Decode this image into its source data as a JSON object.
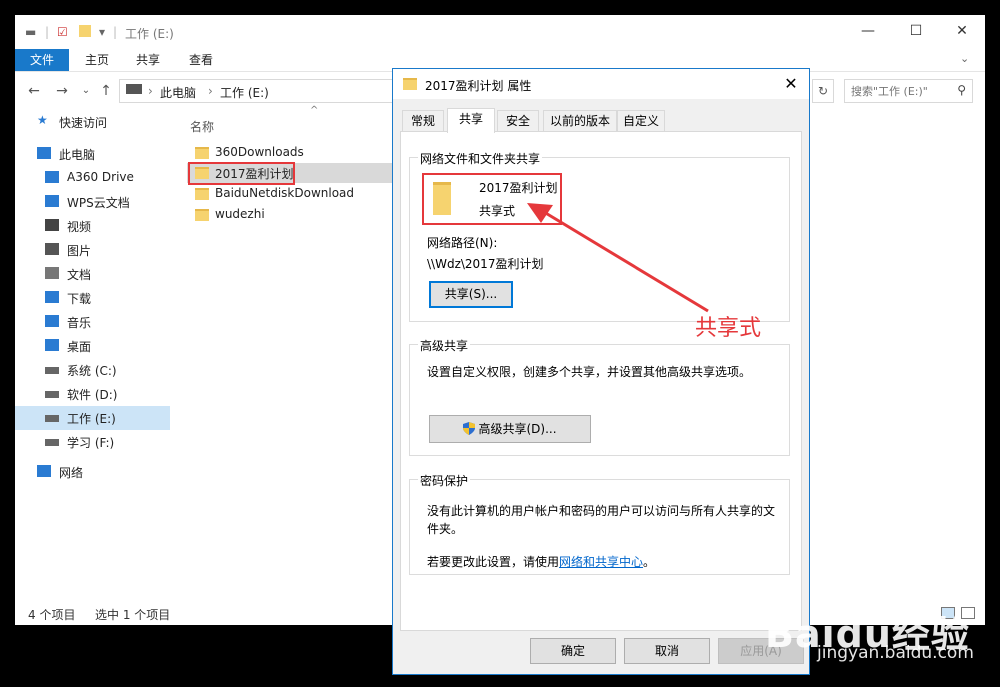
{
  "explorer": {
    "title": "工作 (E:)",
    "ribbon_tabs": [
      "文件",
      "主页",
      "共享",
      "查看"
    ],
    "breadcrumb": [
      "此电脑",
      "工作 (E:)"
    ],
    "search_placeholder": "搜索\"工作 (E:)\"",
    "column_name": "名称",
    "sidebar": [
      {
        "label": "快速访问",
        "icon": "star-icon"
      },
      {
        "label": "此电脑",
        "icon": "computer-icon"
      },
      {
        "label": "A360 Drive",
        "icon": "cloud-icon"
      },
      {
        "label": "WPS云文档",
        "icon": "cloud-icon"
      },
      {
        "label": "视频",
        "icon": "video-icon"
      },
      {
        "label": "图片",
        "icon": "picture-icon"
      },
      {
        "label": "文档",
        "icon": "document-icon"
      },
      {
        "label": "下载",
        "icon": "download-icon"
      },
      {
        "label": "音乐",
        "icon": "music-icon"
      },
      {
        "label": "桌面",
        "icon": "desktop-icon"
      },
      {
        "label": "系统 (C:)",
        "icon": "drive-icon"
      },
      {
        "label": "软件 (D:)",
        "icon": "drive-icon"
      },
      {
        "label": "工作 (E:)",
        "icon": "drive-icon",
        "selected": true
      },
      {
        "label": "学习 (F:)",
        "icon": "drive-icon"
      },
      {
        "label": "网络",
        "icon": "network-icon"
      }
    ],
    "files": [
      {
        "name": "360Downloads"
      },
      {
        "name": "2017盈利计划",
        "selected": true
      },
      {
        "name": "BaiduNetdiskDownload"
      },
      {
        "name": "wudezhi"
      }
    ],
    "status": {
      "count": "4 个项目",
      "selection": "选中 1 个项目"
    }
  },
  "dialog": {
    "title": "2017盈利计划 属性",
    "tabs": [
      "常规",
      "共享",
      "安全",
      "以前的版本",
      "自定义"
    ],
    "network_group": {
      "title": "网络文件和文件夹共享",
      "folder_name": "2017盈利计划",
      "share_state": "共享式",
      "path_label": "网络路径(N):",
      "path_value": "\\\\Wdz\\2017盈利计划",
      "share_button": "共享(S)..."
    },
    "advanced_group": {
      "title": "高级共享",
      "description": "设置自定义权限，创建多个共享，并设置其他高级共享选项。",
      "button": "高级共享(D)..."
    },
    "password_group": {
      "title": "密码保护",
      "description_line1": "没有此计算机的用户帐户和密码的用户可以访问与所有人共享的文",
      "description_line2": "件夹。",
      "change_prefix": "若要更改此设置，请使用",
      "link": "网络和共享中心",
      "change_suffix": "。"
    },
    "buttons": {
      "ok": "确定",
      "cancel": "取消",
      "apply": "应用(A)"
    }
  },
  "annotation": "共享式",
  "watermark": {
    "logo": "Baidu经验",
    "url": "jingyan.baidu.com"
  },
  "colors": {
    "accent": "#1979ca",
    "highlight": "#e5383b",
    "folder": "#f6d36f"
  }
}
